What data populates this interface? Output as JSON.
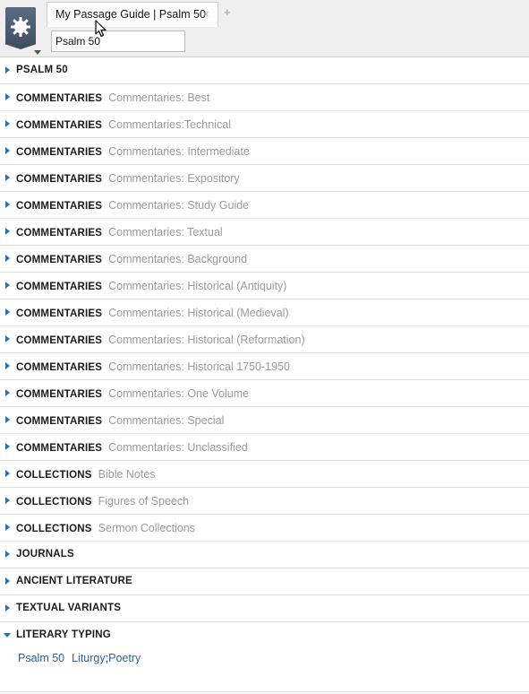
{
  "tab": {
    "title": "My Passage Guide | Psalm 50",
    "close_glyph": "×",
    "add_glyph": "+"
  },
  "reference": {
    "value": "Psalm 50"
  },
  "sections": [
    {
      "label": "PSALM 50",
      "sub": ""
    },
    {
      "label": "COMMENTARIES",
      "sub": "Commentaries: Best"
    },
    {
      "label": "COMMENTARIES",
      "sub": "Commentaries:Technical"
    },
    {
      "label": "COMMENTARIES",
      "sub": "Commentaries: Intermediate"
    },
    {
      "label": "COMMENTARIES",
      "sub": "Commentaries: Expository"
    },
    {
      "label": "COMMENTARIES",
      "sub": "Commentaries: Study Guide"
    },
    {
      "label": "COMMENTARIES",
      "sub": "Commentaries: Textual"
    },
    {
      "label": "COMMENTARIES",
      "sub": "Commentaries: Background"
    },
    {
      "label": "COMMENTARIES",
      "sub": "Commentaries: Historical (Antiquity)"
    },
    {
      "label": "COMMENTARIES",
      "sub": "Commentaries: Historical (Medieval)"
    },
    {
      "label": "COMMENTARIES",
      "sub": "Commentaries: Historical (Reformation)"
    },
    {
      "label": "COMMENTARIES",
      "sub": "Commentaries: Historical 1750-1950"
    },
    {
      "label": "COMMENTARIES",
      "sub": "Commentaries: One Volume"
    },
    {
      "label": "COMMENTARIES",
      "sub": "Commentaries: Special"
    },
    {
      "label": "COMMENTARIES",
      "sub": "Commentaries: Unclassified"
    },
    {
      "label": "COLLECTIONS",
      "sub": "Bible Notes"
    },
    {
      "label": "COLLECTIONS",
      "sub": "Figures of Speech"
    },
    {
      "label": "COLLECTIONS",
      "sub": "Sermon Collections"
    },
    {
      "label": "JOURNALS",
      "sub": ""
    },
    {
      "label": "ANCIENT LITERATURE",
      "sub": ""
    },
    {
      "label": "TEXTUAL VARIANTS",
      "sub": ""
    }
  ],
  "literary_typing": {
    "label": "LITERARY TYPING",
    "reference": "Psalm 50",
    "types": [
      "Liturgy",
      "Poetry"
    ],
    "separator": ";"
  },
  "icons": {
    "app_menu": "gear-icon",
    "expand": "triangle-right-icon",
    "collapse": "triangle-down-icon",
    "cursor": "mouse-pointer-icon"
  },
  "colors": {
    "link": "#2266a8",
    "expander": "#2a6fb0",
    "muted": "#9a9a9a",
    "app_button": "#4b5a70"
  }
}
